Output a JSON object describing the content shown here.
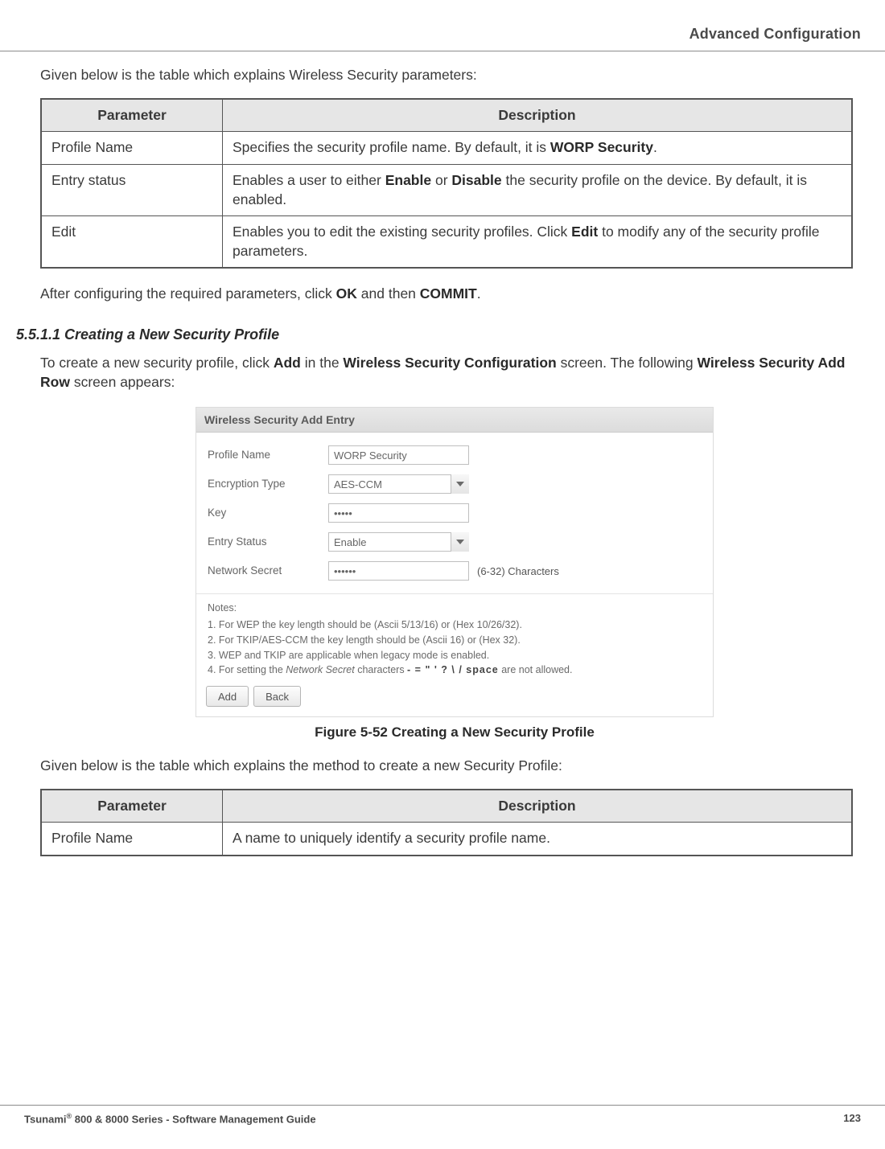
{
  "header": {
    "title": "Advanced Configuration"
  },
  "intro1": "Given below is the table which explains Wireless Security parameters:",
  "table1": {
    "headers": {
      "param": "Parameter",
      "desc": "Description"
    },
    "rows": [
      {
        "param": "Profile Name",
        "desc_pre": "Specifies the security profile name. By default, it is ",
        "desc_b1": "WORP Security",
        "desc_post": "."
      },
      {
        "param": "Entry status",
        "desc_pre": "Enables a user to either ",
        "desc_b1": "Enable",
        "desc_mid": " or ",
        "desc_b2": "Disable",
        "desc_post": " the security profile on the device. By default, it is enabled."
      },
      {
        "param": "Edit",
        "desc_pre": "Enables you to edit the existing security profiles. Click ",
        "desc_b1": "Edit",
        "desc_post": " to modify any of the security profile parameters."
      }
    ]
  },
  "para_after_t1": {
    "pre": "After configuring the required parameters, click ",
    "b1": "OK",
    "mid": " and then ",
    "b2": "COMMIT",
    "post": "."
  },
  "section": {
    "number": "5.5.1.1 Creating a New Security Profile",
    "para": {
      "pre": "To create a new security profile, click ",
      "b1": "Add",
      "mid1": " in the ",
      "b2": "Wireless Security Configuration",
      "mid2": " screen. The following ",
      "b3": "Wireless Security Add Row",
      "post": " screen appears:"
    }
  },
  "figure": {
    "title": "Wireless Security Add Entry",
    "fields": {
      "profile": {
        "label": "Profile Name",
        "value": "WORP Security"
      },
      "enc": {
        "label": "Encryption Type",
        "value": "AES-CCM"
      },
      "key": {
        "label": "Key",
        "value": "•••••"
      },
      "status": {
        "label": "Entry Status",
        "value": "Enable"
      },
      "secret": {
        "label": "Network Secret",
        "value": "••••••",
        "hint": "(6-32) Characters"
      }
    },
    "notes_label": "Notes:",
    "notes": [
      "1. For WEP the key length should be (Ascii 5/13/16) or (Hex 10/26/32).",
      "2. For TKIP/AES-CCM the key length should be (Ascii 16) or (Hex 32).",
      "3. WEP and TKIP are applicable when legacy mode is enabled."
    ],
    "note4_pre": "4. For setting the ",
    "note4_it": "Network Secret",
    "note4_mid": " characters   ",
    "note4_mono": "- = \" ' ? \\ / space",
    "note4_post": "  are not allowed.",
    "buttons": {
      "add": "Add",
      "back": "Back"
    },
    "caption": "Figure 5-52 Creating a New Security Profile"
  },
  "intro2": "Given below is the table which explains the method to create a new Security Profile:",
  "table2": {
    "headers": {
      "param": "Parameter",
      "desc": "Description"
    },
    "rows": [
      {
        "param": "Profile Name",
        "desc": "A name to uniquely identify a security profile name."
      }
    ]
  },
  "footer": {
    "left_pre": "Tsunami",
    "left_sup": "®",
    "left_post": " 800 & 8000 Series - Software Management Guide",
    "page": "123"
  }
}
